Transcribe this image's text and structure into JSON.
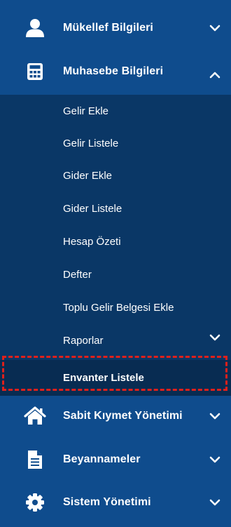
{
  "sidebar": {
    "top_items": [
      {
        "label": "Mükellef Bilgileri",
        "icon": "user-icon",
        "expanded": false
      },
      {
        "label": "Muhasebe Bilgileri",
        "icon": "calculator-icon",
        "expanded": true
      },
      {
        "label": "Sabit Kıymet Yönetimi",
        "icon": "home-icon",
        "expanded": false
      },
      {
        "label": "Beyannameler",
        "icon": "document-icon",
        "expanded": false
      },
      {
        "label": "Sistem Yönetimi",
        "icon": "gear-icon",
        "expanded": false
      }
    ],
    "submenu": [
      {
        "label": "Gelir Ekle"
      },
      {
        "label": "Gelir Listele"
      },
      {
        "label": "Gider Ekle"
      },
      {
        "label": "Gider Listele"
      },
      {
        "label": "Hesap Özeti"
      },
      {
        "label": "Defter"
      },
      {
        "label": "Toplu Gelir Belgesi Ekle"
      },
      {
        "label": "Raporlar",
        "has_children": true
      },
      {
        "label": "Envanter Listele",
        "active": true
      }
    ]
  },
  "colors": {
    "sidebar_bg": "#0f4c8d",
    "submenu_bg": "#0a3766",
    "active_bg": "#082c52",
    "highlight": "#e0201b",
    "text": "#ffffff"
  }
}
